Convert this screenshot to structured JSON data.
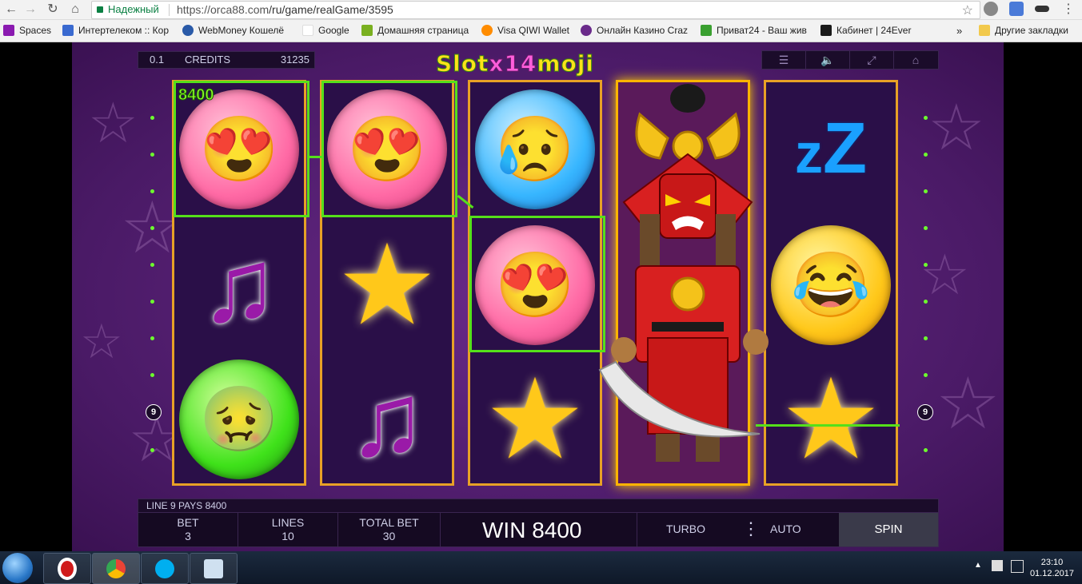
{
  "browser": {
    "secure_label": "Надежный",
    "url_host": "https://orca88.com",
    "url_path": "/ru/game/realGame/3595"
  },
  "bookmarks": [
    {
      "label": "Spaces",
      "color": "#8a1ab0"
    },
    {
      "label": "Интертелеком :: Кор",
      "color": "#3a6ad0"
    },
    {
      "label": "WebMoney Кошелё",
      "color": "#2a5aa8"
    },
    {
      "label": "Google",
      "color": "#4285f4"
    },
    {
      "label": "Домашняя страница",
      "color": "#7ab020"
    },
    {
      "label": "Visa QIWI Wallet",
      "color": "#ff8c00"
    },
    {
      "label": "Онлайн Казино Craz",
      "color": "#6a2a8a"
    },
    {
      "label": "Приват24 - Ваш жив",
      "color": "#3aa030"
    },
    {
      "label": "Кабинет | 24Ever",
      "color": "#1a1a1a"
    },
    {
      "label": "Другие закладки",
      "color": "#f2c94c"
    }
  ],
  "game": {
    "denom": "0.1",
    "credits_label": "CREDITS",
    "credits_value": "31235",
    "logo_left": "Slot",
    "logo_mid": "x14",
    "logo_right": "moji",
    "win_badge": "8400",
    "line_badge_left": "9",
    "line_badge_right": "9",
    "pays_text": "LINE 9 PAYS 8400",
    "bet_label": "BET",
    "bet_value": "3",
    "lines_label": "LINES",
    "lines_value": "10",
    "total_bet_label": "TOTAL BET",
    "total_bet_value": "30",
    "win_text": "WIN 8400",
    "turbo_label": "TURBO",
    "auto_label": "AUTO",
    "spin_label": "SPIN"
  },
  "taskbar": {
    "time": "23:10",
    "date": "01.12.2017"
  }
}
